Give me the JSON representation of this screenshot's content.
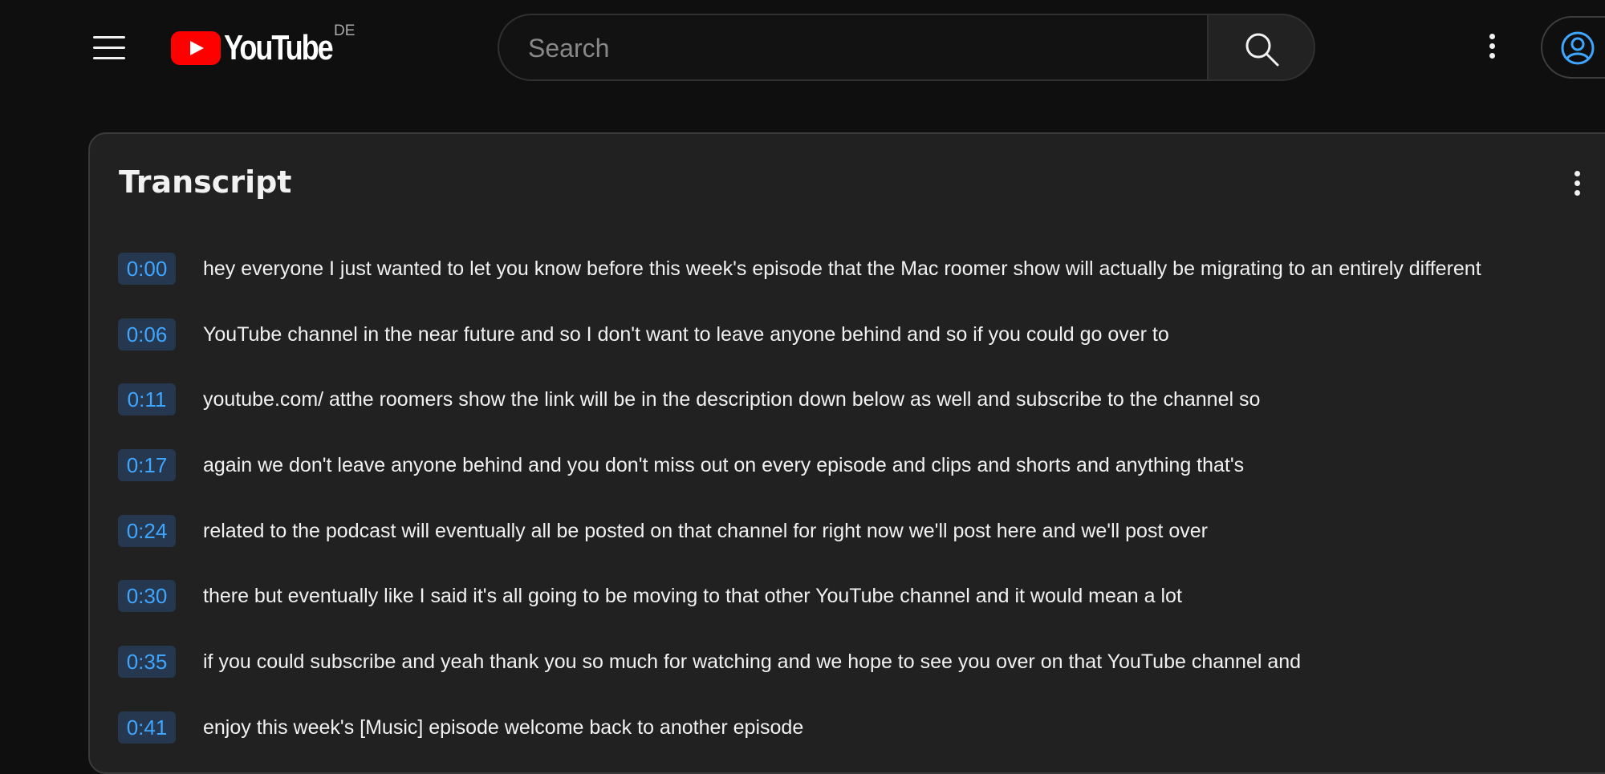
{
  "header": {
    "logo_text": "YouTube",
    "region": "DE",
    "search_placeholder": "Search",
    "icons": {
      "menu": "hamburger-menu-icon",
      "search": "search-icon",
      "more": "more-vertical-icon",
      "account": "account-circle-icon"
    }
  },
  "transcript": {
    "title": "Transcript",
    "segments": [
      {
        "time": "0:00",
        "text": "hey everyone I just wanted to let you know before this week's episode that the Mac roomer show will actually be migrating to an entirely different"
      },
      {
        "time": "0:06",
        "text": "YouTube channel in the near future and so I don't want to leave anyone behind and so if you could go over to"
      },
      {
        "time": "0:11",
        "text": "youtube.com/ atthe roomers show the link will be in the description down below as well and subscribe to the channel so"
      },
      {
        "time": "0:17",
        "text": "again we don't leave anyone behind and you don't miss out on every episode and clips and shorts and anything that's"
      },
      {
        "time": "0:24",
        "text": "related to the podcast will eventually all be posted on that channel for right now we'll post here and we'll post over"
      },
      {
        "time": "0:30",
        "text": "there but eventually like I said it's all going to be moving to that other YouTube channel and it would mean a lot"
      },
      {
        "time": "0:35",
        "text": "if you could subscribe and yeah thank you so much for watching and we hope to see you over on that YouTube channel and"
      },
      {
        "time": "0:41",
        "text": "enjoy this week's [Music] episode welcome back to another episode"
      }
    ]
  },
  "colors": {
    "background": "#0f0f0f",
    "panel": "#212121",
    "timestamp_bg": "#263850",
    "timestamp_text": "#3ea6ff",
    "brand_red": "#ff0000"
  }
}
